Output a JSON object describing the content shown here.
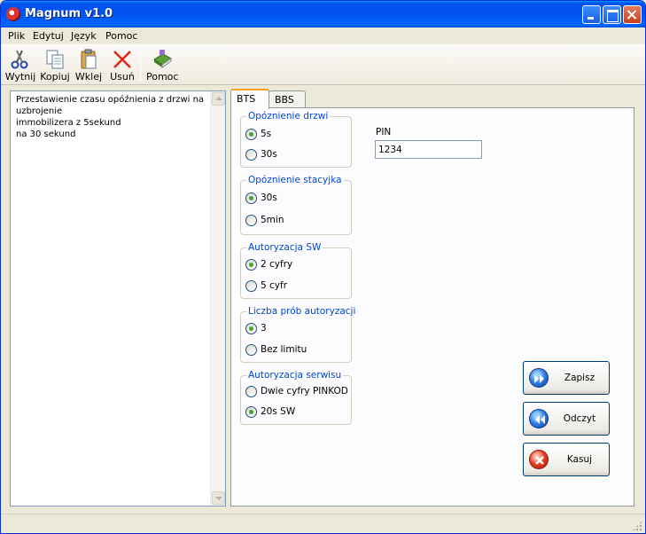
{
  "window": {
    "title": "Magnum v1.0",
    "icon": "app-icon"
  },
  "menu": {
    "items": [
      {
        "label": "Plik"
      },
      {
        "label": "Edytuj"
      },
      {
        "label": "Język"
      },
      {
        "label": "Pomoc"
      }
    ]
  },
  "toolbar": {
    "cut": {
      "label": "Wytnij",
      "icon": "scissors-icon"
    },
    "copy": {
      "label": "Kopiuj",
      "icon": "copy-icon"
    },
    "paste": {
      "label": "Wklej",
      "icon": "paste-icon"
    },
    "delete": {
      "label": "Usuń",
      "icon": "delete-icon"
    },
    "help": {
      "label": "Pomoc",
      "icon": "help-book-icon"
    }
  },
  "description": {
    "text": "Przestawienie czasu opóźnienia z drzwi na uzbrojenie\nimmobilizera z 5sekund\nna 30 sekund"
  },
  "tabs": [
    {
      "label": "BTS",
      "active": true
    },
    {
      "label": "BBS",
      "active": false
    }
  ],
  "groups": {
    "door_delay": {
      "title": "Opóznienie drzwi",
      "options": [
        {
          "label": "5s",
          "checked": true
        },
        {
          "label": "30s",
          "checked": false
        }
      ]
    },
    "ignition_delay": {
      "title": "Opóznienie stacyjka",
      "options": [
        {
          "label": "30s",
          "checked": true
        },
        {
          "label": "5min",
          "checked": false
        }
      ]
    },
    "sw_auth": {
      "title": "Autoryzacja SW",
      "options": [
        {
          "label": "2 cyfry",
          "checked": true
        },
        {
          "label": "5 cyfr",
          "checked": false
        }
      ]
    },
    "auth_attempts": {
      "title": "Liczba prób autoryzacji",
      "options": [
        {
          "label": "3",
          "checked": true
        },
        {
          "label": "Bez limitu",
          "checked": false
        }
      ]
    },
    "service_auth": {
      "title": "Autoryzacja serwisu",
      "options": [
        {
          "label": "Dwie cyfry PINKOD",
          "checked": false
        },
        {
          "label": "20s SW",
          "checked": true
        }
      ]
    }
  },
  "pin": {
    "label": "PIN",
    "value": "1234"
  },
  "actions": {
    "save": {
      "label": "Zapisz",
      "icon": "forward-icon"
    },
    "read": {
      "label": "Odczyt",
      "icon": "rewind-icon"
    },
    "cancel": {
      "label": "Kasuj",
      "icon": "cancel-icon"
    }
  },
  "colors": {
    "titlebar": "#0054E3",
    "group_title": "#0046D5",
    "radio_checked": "#3DAA27",
    "tab_active_accent": "#FF9B1F"
  }
}
